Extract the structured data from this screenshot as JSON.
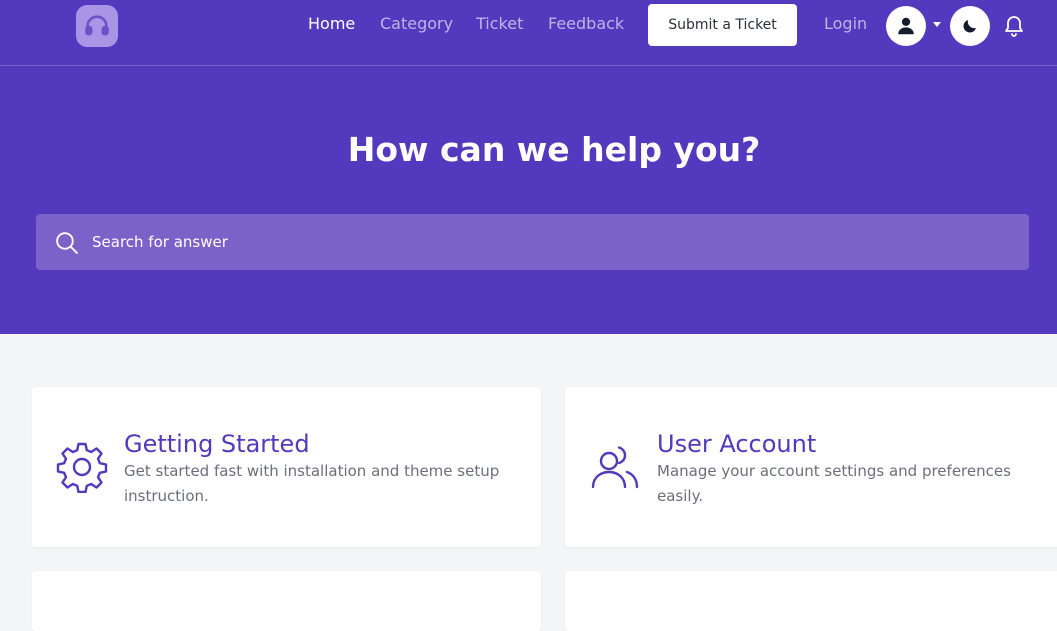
{
  "colors": {
    "brand": "#5339bd",
    "search_bg": "#7b62c9",
    "page_bg": "#f4f5f7",
    "card_bg": "#ffffff"
  },
  "nav": {
    "logo_icon": "headset-icon",
    "links": [
      {
        "label": "Home",
        "active": true
      },
      {
        "label": "Category",
        "active": false
      },
      {
        "label": "Ticket",
        "active": false
      },
      {
        "label": "Feedback",
        "active": false
      }
    ],
    "submit_ticket_label": "Submit a Ticket",
    "login_label": "Login",
    "avatar_icon": "user-icon",
    "theme_icon": "moon-icon",
    "notifications_icon": "bell-icon"
  },
  "hero": {
    "title": "How can we help you?",
    "search_placeholder": "Search for answer"
  },
  "cards": [
    {
      "icon": "gear-icon",
      "title": "Getting Started",
      "description": "Get started fast with installation and theme setup instruction."
    },
    {
      "icon": "users-icon",
      "title": "User Account",
      "description": "Manage your account settings and preferences easily."
    }
  ]
}
